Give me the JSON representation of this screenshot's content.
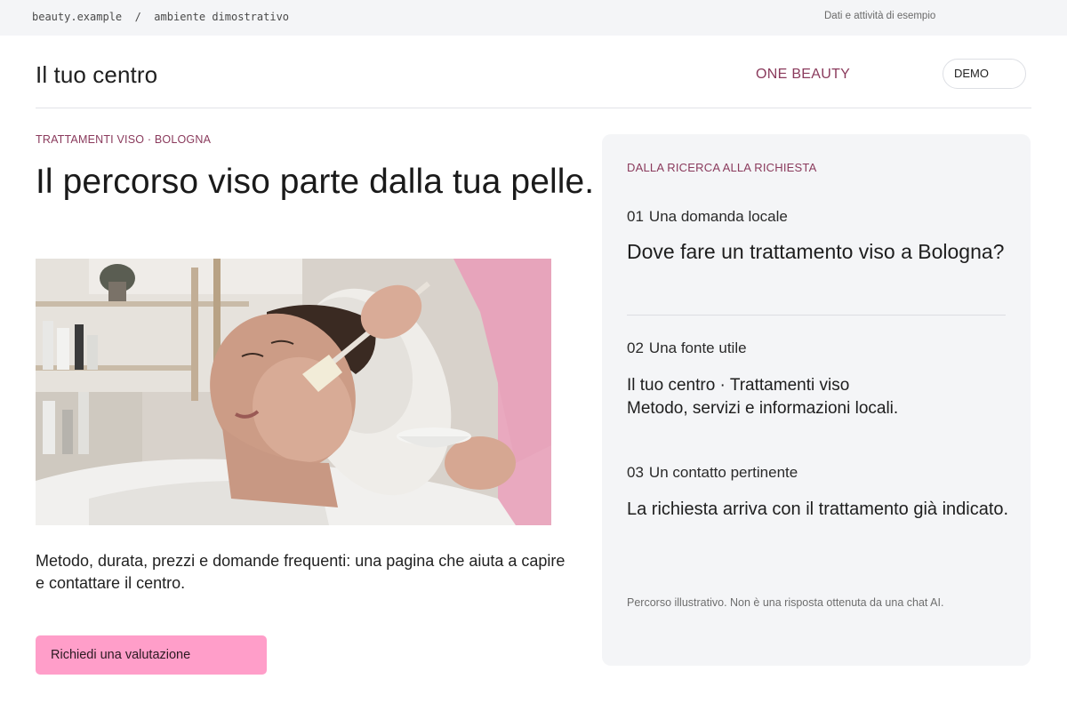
{
  "topbar": {
    "site": "beauty.example",
    "separator": "/",
    "env": "ambiente dimostrativo",
    "note": "Dati e attività di esempio"
  },
  "header": {
    "title": "Il tuo centro",
    "brand": "ONE BEAUTY",
    "badge": "DEMO"
  },
  "hero": {
    "eyebrow": "TRATTAMENTI VISO · BOLOGNA",
    "headline": "Il percorso viso parte dalla tua pelle.",
    "description": "Metodo, durata, prezzi e domande frequenti: una pagina che aiuta a capire e contattare il centro.",
    "cta": "Richiedi una valutazione"
  },
  "journey": {
    "eyebrow": "DALLA RICERCA ALLA RICHIESTA",
    "steps": [
      {
        "num": "01",
        "label": "Una domanda locale",
        "body": "Dove fare un trattamento viso a Bologna?"
      },
      {
        "num": "02",
        "label": "Una fonte utile",
        "body_line1": "Il tuo centro · Trattamenti viso",
        "body_line2": "Metodo, servizi e informazioni locali."
      },
      {
        "num": "03",
        "label": "Un contatto pertinente",
        "body": "La richiesta arriva con il trattamento già indicato."
      }
    ],
    "disclaimer": "Percorso illustrativo. Non è una risposta ottenuta da una chat AI."
  },
  "colors": {
    "accent": "#8a3a5c",
    "cta_bg": "#ff9ec9",
    "card_bg": "#f4f5f7",
    "topbar_bg": "#f4f5f7"
  }
}
